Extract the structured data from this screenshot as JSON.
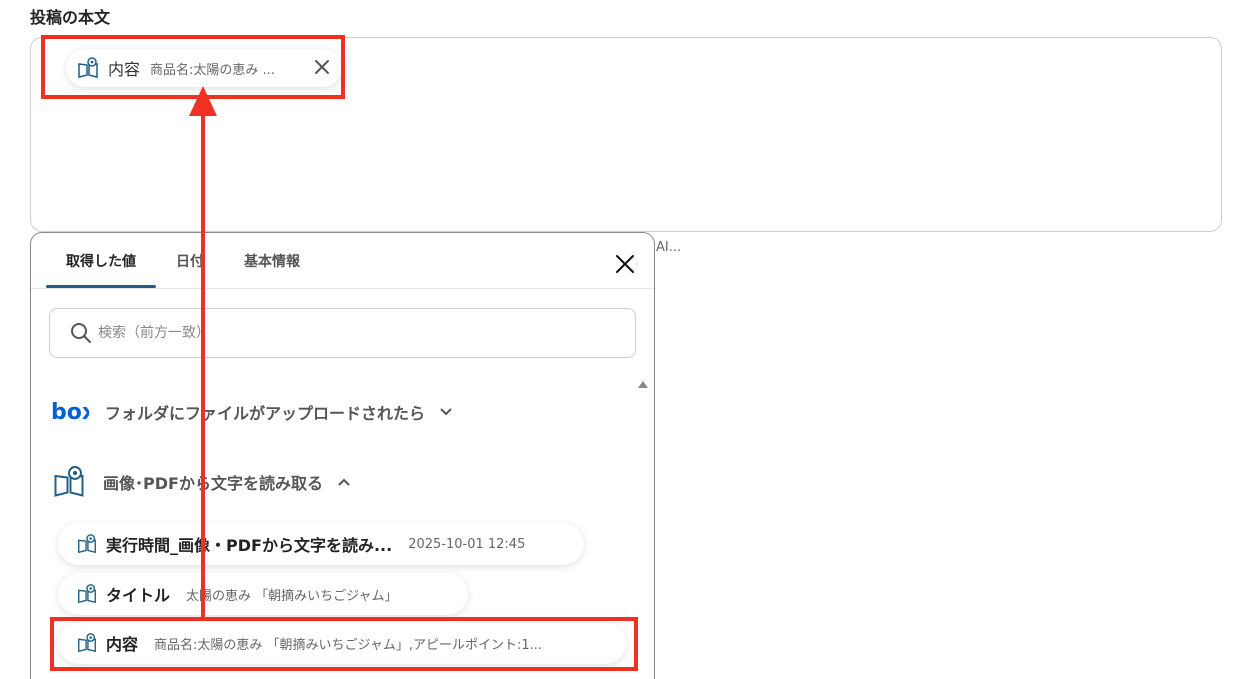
{
  "section_label": "投稿の本文",
  "token": {
    "label": "内容",
    "value": "商品名:太陽の恵み ..."
  },
  "hint_text": "AI...",
  "panel": {
    "tabs": [
      {
        "label": "取得した値",
        "active": true
      },
      {
        "label": "日付",
        "active": false
      },
      {
        "label": "基本情報",
        "active": false
      }
    ],
    "search_placeholder": "検索（前方一致）",
    "groups": [
      {
        "icon": "box-logo",
        "label": "フォルダにファイルがアップロードされたら",
        "expanded": false
      },
      {
        "icon": "book-eye-icon",
        "label": "画像･PDFから文字を読み取る",
        "expanded": true
      }
    ],
    "items": [
      {
        "label": "実行時間_画像・PDFから文字を読み...",
        "value": "2025-10-01 12:45"
      },
      {
        "label": "タイトル",
        "value": "太陽の恵み 「朝摘みいちごジャム」"
      },
      {
        "label": "内容",
        "value": "商品名:太陽の恵み 「朝摘みいちごジャム」,アピールポイント:1..."
      }
    ]
  },
  "colors": {
    "accent": "#1f5f86",
    "highlight": "#ee3124",
    "box_brand": "#0061d5"
  }
}
